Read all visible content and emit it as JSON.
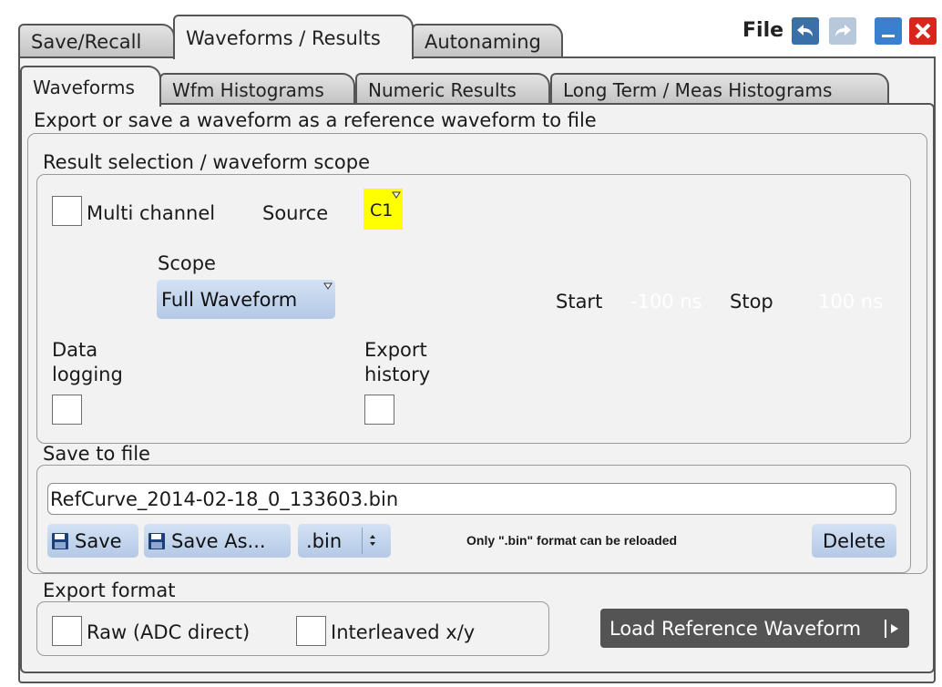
{
  "title_bar": {
    "label": "File",
    "colors": {
      "undo": "#3b6fa8",
      "redo": "#b7c8dd",
      "minimize": "#3b7fcf",
      "close": "#d8261c"
    }
  },
  "file_tabs": [
    "Save/Recall",
    "Waveforms / Results",
    "Autonaming"
  ],
  "sub_tabs": [
    "Waveforms",
    "Wfm Histograms",
    "Numeric Results",
    "Long Term / Meas Histograms"
  ],
  "description": "Export or save a waveform as a reference waveform to file",
  "result_selection": {
    "title": "Result selection / waveform scope",
    "multi_channel_label": "Multi channel",
    "multi_channel_checked": false,
    "source_label": "Source",
    "source_value": "C1",
    "source_color": "#ffff00",
    "scope_label": "Scope",
    "scope_value": "Full Waveform",
    "start_label": "Start",
    "start_value": "-100 ns",
    "stop_label": "Stop",
    "stop_value": "100 ns",
    "data_logging_line1": "Data",
    "data_logging_line2": "logging",
    "data_logging_checked": false,
    "export_history_line1": "Export",
    "export_history_line2": "history",
    "export_history_checked": false
  },
  "save_to_file": {
    "title": "Save to file",
    "filename": "RefCurve_2014-02-18_0_133603.bin",
    "save_label": "Save",
    "save_as_label": "Save As...",
    "format_value": ".bin",
    "note": "Only \".bin\" format can be reloaded",
    "delete_label": "Delete"
  },
  "export_format": {
    "title": "Export format",
    "raw_label": "Raw (ADC direct)",
    "raw_checked": false,
    "interleaved_label": "Interleaved x/y",
    "interleaved_checked": false
  },
  "load_reference_label": "Load Reference Waveform"
}
